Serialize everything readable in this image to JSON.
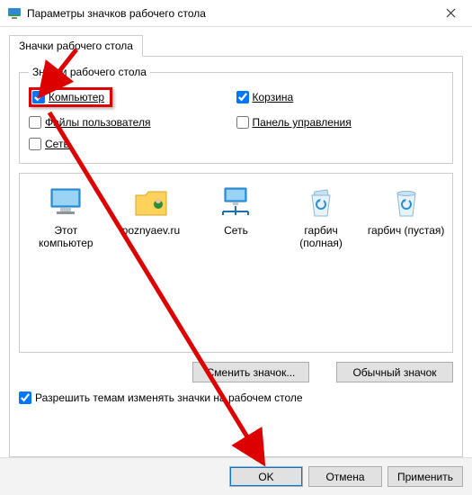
{
  "titlebar": {
    "title": "Параметры значков рабочего стола"
  },
  "tab_label": "Значки рабочего стола",
  "group_label": "Значки рабочего стола",
  "checkboxes": {
    "computer": "Компьютер",
    "recycle": "Корзина",
    "userfiles": "Файлы пользователя",
    "controlpanel": "Панель управления",
    "network": "Сеть"
  },
  "icons": [
    {
      "label": "Этот компьютер"
    },
    {
      "label": "poznyaev.ru"
    },
    {
      "label": "Сеть"
    },
    {
      "label": "гарбич (полная)"
    },
    {
      "label": "гарбич (пустая)"
    }
  ],
  "buttons": {
    "change_icon": "Сменить значок...",
    "default_icon": "Обычный значок"
  },
  "theme_check": "Разрешить темам изменять значки на рабочем столе",
  "footer": {
    "ok": "OK",
    "cancel": "Отмена",
    "apply": "Применить"
  }
}
